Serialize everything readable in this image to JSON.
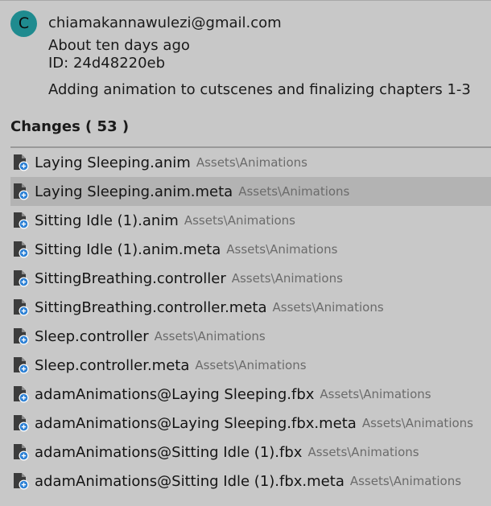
{
  "commit": {
    "avatar_initial": "C",
    "author_email": "chiamakannawulezi@gmail.com",
    "date": "About ten days ago",
    "id": "ID: 24d48220eb",
    "message": "Adding animation to cutscenes and finalizing chapters 1-3"
  },
  "changes": {
    "title": "Changes ( 53 )",
    "icon": "file-added-icon",
    "accent_color": "#2a7fd4",
    "items": [
      {
        "name": "Laying Sleeping.anim",
        "path": "Assets\\Animations"
      },
      {
        "name": "Laying Sleeping.anim.meta",
        "path": "Assets\\Animations"
      },
      {
        "name": "Sitting Idle (1).anim",
        "path": "Assets\\Animations"
      },
      {
        "name": "Sitting Idle (1).anim.meta",
        "path": "Assets\\Animations"
      },
      {
        "name": "SittingBreathing.controller",
        "path": "Assets\\Animations"
      },
      {
        "name": "SittingBreathing.controller.meta",
        "path": "Assets\\Animations"
      },
      {
        "name": "Sleep.controller",
        "path": "Assets\\Animations"
      },
      {
        "name": "Sleep.controller.meta",
        "path": "Assets\\Animations"
      },
      {
        "name": "adamAnimations@Laying Sleeping.fbx",
        "path": "Assets\\Animations"
      },
      {
        "name": "adamAnimations@Laying Sleeping.fbx.meta",
        "path": "Assets\\Animations"
      },
      {
        "name": "adamAnimations@Sitting Idle (1).fbx",
        "path": "Assets\\Animations"
      },
      {
        "name": "adamAnimations@Sitting Idle (1).fbx.meta",
        "path": "Assets\\Animations"
      }
    ]
  }
}
